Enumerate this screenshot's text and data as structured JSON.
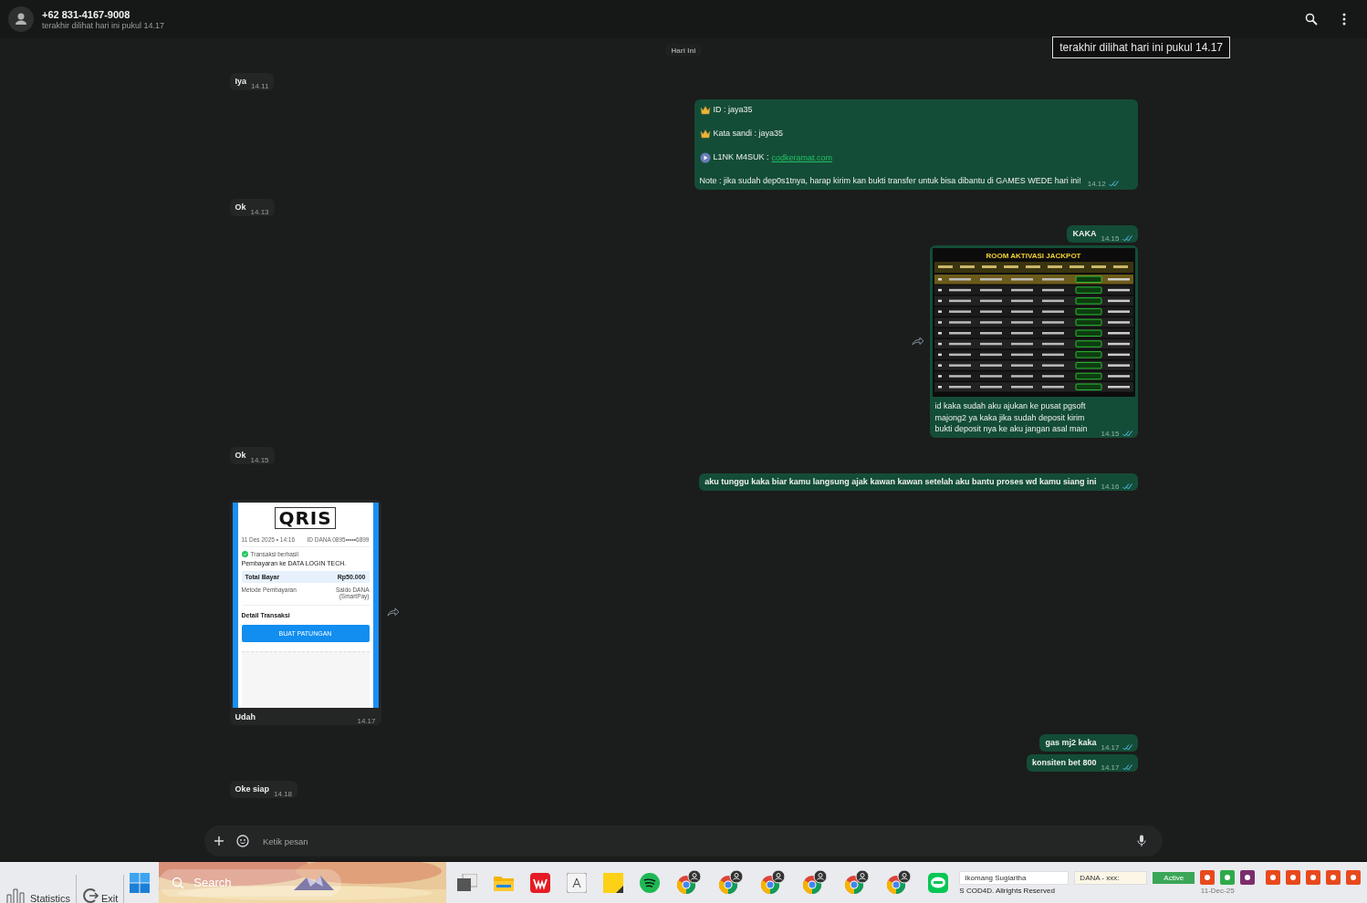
{
  "header": {
    "contact": "+62 831-4167-9008",
    "status": "terakhir dilihat hari ini pukul 14.17"
  },
  "tooltip": "terakhir dilihat hari ini pukul 14.17",
  "date_chip": "Hari Ini",
  "messages": [
    {
      "kind": "text",
      "outgoing": false,
      "text": "Iya",
      "time": "14.11"
    },
    {
      "kind": "info",
      "outgoing": true,
      "lines": [
        {
          "kind": "crown",
          "text": "ID :  jaya35"
        },
        {
          "kind": "crown",
          "text": "Kata sandi : jaya35"
        },
        {
          "kind": "play",
          "text": "L1NK M4SUK : ",
          "link": "codkeramat.com"
        },
        {
          "kind": "plain",
          "text": "Note : jika sudah dep0s1tnya, harap kirim kan bukti transfer untuk bisa dibantu di GAMES WEDE hari ini!"
        }
      ],
      "time": "14.12",
      "read": true
    },
    {
      "kind": "text",
      "outgoing": false,
      "text": "Ok",
      "time": "14.13"
    },
    {
      "kind": "text",
      "outgoing": true,
      "text": "KAKA",
      "time": "14.15",
      "read": true
    },
    {
      "kind": "table_image",
      "outgoing": true,
      "forward": true,
      "title": "ROOM AKTIVASI JACKPOT",
      "caption": "id kaka sudah aku ajukan ke pusat pgsoft majong2 ya kaka jika sudah deposit kirim bukti deposit nya ke aku jangan asal main",
      "time": "14.15",
      "read": true
    },
    {
      "kind": "text",
      "outgoing": false,
      "text": "Ok",
      "time": "14.15"
    },
    {
      "kind": "text",
      "outgoing": true,
      "text": "aku tunggu kaka biar kamu langsung ajak kawan kawan setelah aku bantu proses wd kamu siang ini",
      "time": "14.16",
      "read": true
    },
    {
      "kind": "receipt",
      "outgoing": false,
      "forward": true,
      "receipt": {
        "logo": "QRIS",
        "date": "11 Des 2025 • 14:16",
        "account": "ID DANA 0895•••••6899",
        "status": "Transaksi berhasil",
        "payee": "Pembayaran ke DATA LOGIN TECH.",
        "total_label": "Total Bayar",
        "total": "Rp50.000",
        "method_label": "Metode Pembayaran",
        "method": "Saldo DANA (SmartPay)",
        "detail": "Detail Transaksi",
        "button": "BUAT PATUNGAN"
      },
      "caption": "Udah",
      "time": "14.17"
    },
    {
      "kind": "text",
      "outgoing": true,
      "text": "gas mj2 kaka",
      "time": "14.17",
      "read": true
    },
    {
      "kind": "text",
      "outgoing": true,
      "text": "konsiten bet 800",
      "time": "14.17",
      "read": true
    },
    {
      "kind": "text",
      "outgoing": false,
      "text": "Oke siap",
      "time": "14.18"
    }
  ],
  "composer": {
    "placeholder": "Ketik pesan"
  },
  "taskbar": {
    "left": [
      {
        "kind": "stats",
        "label": "Statistics"
      },
      {
        "kind": "exit",
        "label": "Exit"
      }
    ],
    "search": "Search",
    "page_footer": "S COD4D. Allrights Reserved",
    "fields": [
      "Ikomang Sugiartha",
      "DANA - xxx:"
    ],
    "active_button": "Active",
    "date": "11-Dec-25"
  }
}
